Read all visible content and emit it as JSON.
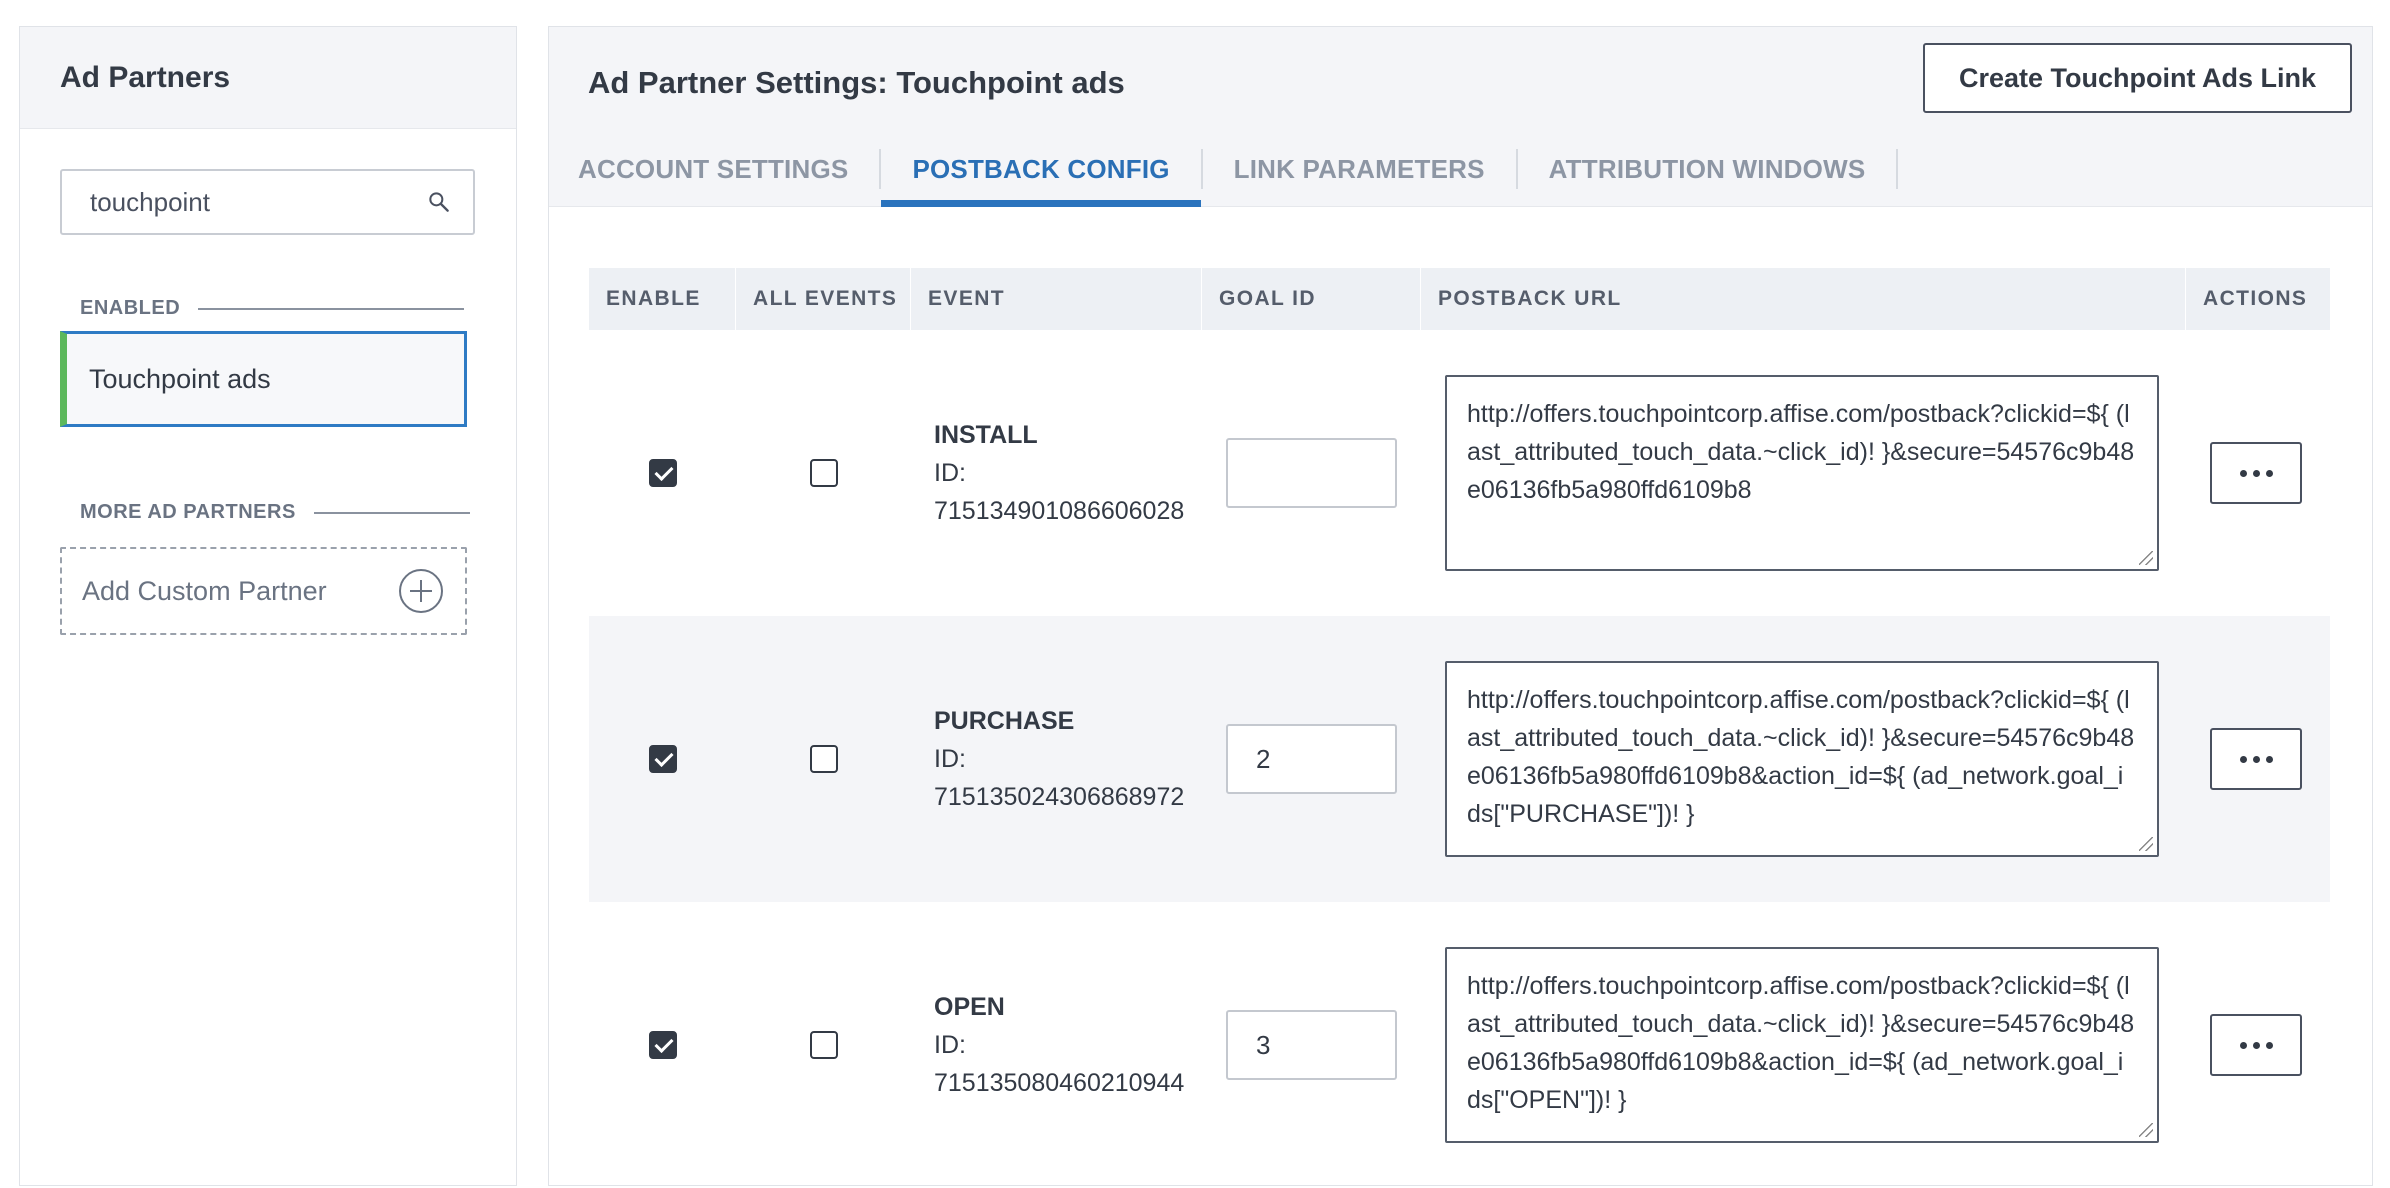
{
  "sidebar": {
    "title": "Ad Partners",
    "search": {
      "value": "touchpoint"
    },
    "enabled_label": "ENABLED",
    "enabled_items": [
      {
        "label": "Touchpoint ads"
      }
    ],
    "more_label": "MORE AD PARTNERS",
    "add_custom_label": "Add Custom Partner"
  },
  "main": {
    "title": "Ad Partner Settings: Touchpoint ads",
    "create_button": "Create Touchpoint Ads Link",
    "tabs": [
      {
        "label": "ACCOUNT SETTINGS",
        "active": false
      },
      {
        "label": "POSTBACK CONFIG",
        "active": true
      },
      {
        "label": "LINK PARAMETERS",
        "active": false
      },
      {
        "label": "ATTRIBUTION WINDOWS",
        "active": false
      }
    ]
  },
  "table": {
    "headers": [
      "ENABLE",
      "ALL EVENTS",
      "EVENT",
      "GOAL ID",
      "POSTBACK URL",
      "ACTIONS"
    ],
    "rows": [
      {
        "enabled": true,
        "all_events": false,
        "event": "INSTALL",
        "id_label": "ID:",
        "id": "715134901086606028",
        "goal_id": "",
        "postback_url": "http://offers.touchpointcorp.affise.com/postback?clickid=${ (last_attributed_touch_data.~click_id)! }&secure=54576c9b48e06136fb5a980ffd6109b8"
      },
      {
        "enabled": true,
        "all_events": false,
        "event": "PURCHASE",
        "id_label": "ID:",
        "id": "715135024306868972",
        "goal_id": "2",
        "postback_url": "http://offers.touchpointcorp.affise.com/postback?clickid=${ (last_attributed_touch_data.~click_id)! }&secure=54576c9b48e06136fb5a980ffd6109b8&action_id=${ (ad_network.goal_ids[\"PURCHASE\"])! }"
      },
      {
        "enabled": true,
        "all_events": false,
        "event": "OPEN",
        "id_label": "ID:",
        "id": "715135080460210944",
        "goal_id": "3",
        "postback_url": "http://offers.touchpointcorp.affise.com/postback?clickid=${ (last_attributed_touch_data.~click_id)! }&secure=54576c9b48e06136fb5a980ffd6109b8&action_id=${ (ad_network.goal_ids[\"OPEN\"])! }"
      }
    ]
  },
  "colors": {
    "accent_blue": "#2a73bd",
    "enabled_green": "#5cb85c",
    "text_dark": "#333a45",
    "muted": "#8d96a4"
  }
}
